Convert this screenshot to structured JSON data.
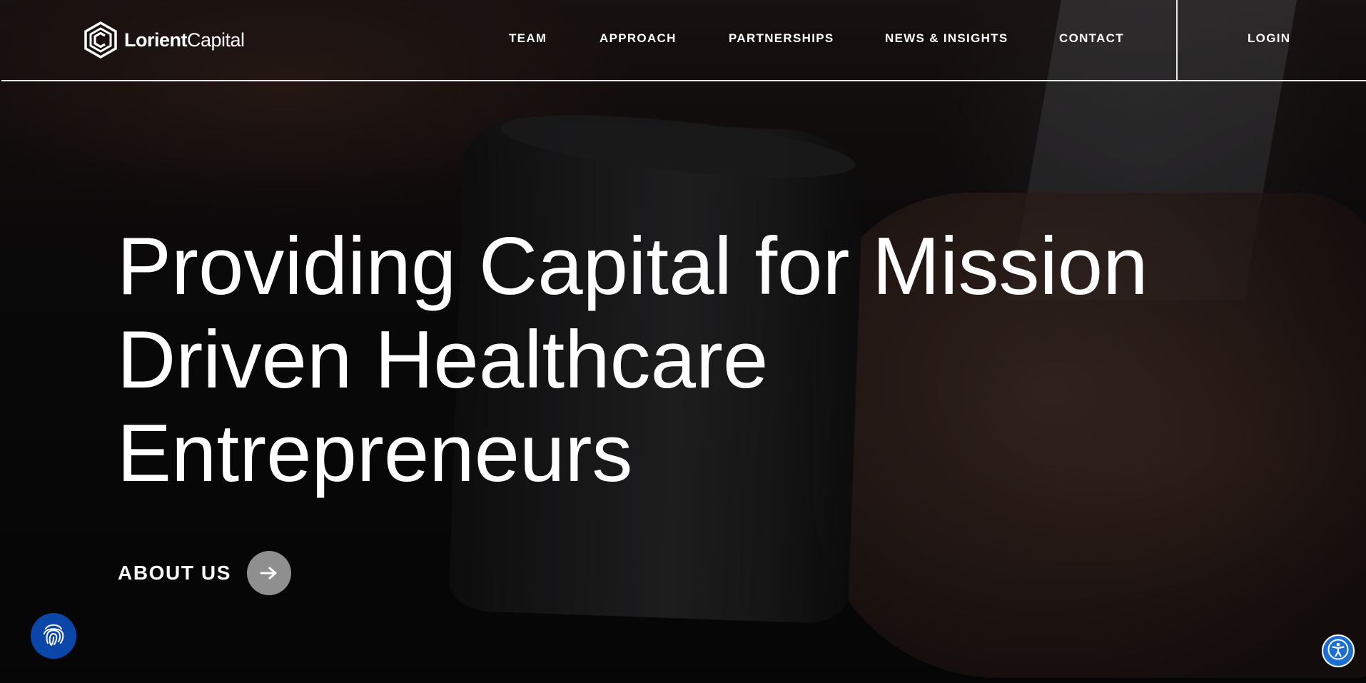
{
  "header": {
    "logo": {
      "brand_bold": "Lorient",
      "brand_regular": "Capital",
      "icon": "hexagon-logo-icon"
    },
    "nav": [
      {
        "label": "TEAM"
      },
      {
        "label": "APPROACH"
      },
      {
        "label": "PARTNERSHIPS"
      },
      {
        "label": "NEWS & INSIGHTS"
      },
      {
        "label": "CONTACT"
      }
    ],
    "login_label": "LOGIN"
  },
  "hero": {
    "headline_line1": "Providing Capital for Mission",
    "headline_line2": "Driven Healthcare",
    "headline_line3": "Entrepreneurs",
    "cta_label": "ABOUT US",
    "cta_icon": "arrow-right-icon"
  },
  "widgets": {
    "left_icon": "fingerprint-icon",
    "right_icon": "accessibility-icon",
    "left_color": "#0a47a9",
    "right_color": "#1a6fd1"
  },
  "colors": {
    "text": "#ffffff",
    "header_border": "#e8e8e8"
  }
}
